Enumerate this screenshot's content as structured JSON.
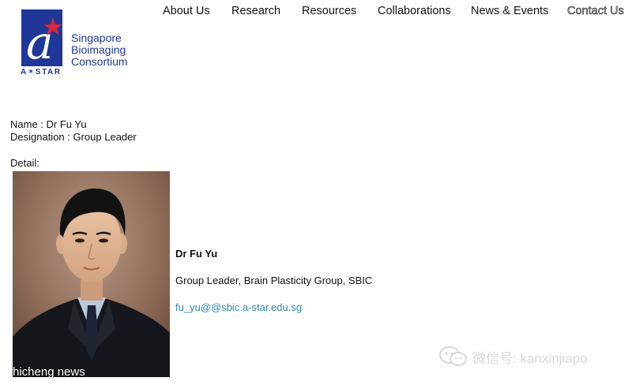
{
  "logo": {
    "mark_letter": "a",
    "org_short": "A✶STAR",
    "org_name_lines": [
      "Singapore",
      "Bioimaging",
      "Consortium"
    ],
    "brand_color": "#1e3799",
    "star_color": "#d8283a"
  },
  "nav": {
    "items": [
      {
        "label": "About Us"
      },
      {
        "label": "Research"
      },
      {
        "label": "Resources"
      },
      {
        "label": "Collaborations"
      },
      {
        "label": "News & Events"
      },
      {
        "label": "Contact Us"
      }
    ]
  },
  "profile": {
    "name_line": "Name : Dr Fu Yu",
    "designation_line": "Designation : Group Leader",
    "detail_label": "Detail:"
  },
  "bio": {
    "name": "Dr Fu Yu",
    "role": "Group Leader, Brain Plasticity Group, SBIC",
    "email": "fu_yu@@sbic.a-star.edu.sg",
    "email_color": "#2a8aa5"
  },
  "photo": {
    "icon": "portrait-photo",
    "watermark": "hicheng news"
  },
  "wechat": {
    "icon": "wechat-icon",
    "text": "微信号: kanxinjiapo"
  }
}
